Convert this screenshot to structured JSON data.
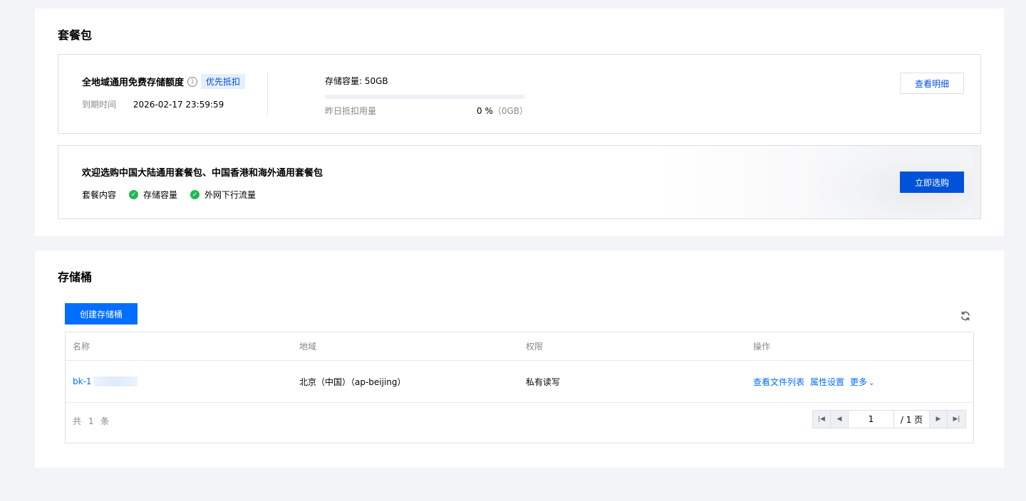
{
  "package_section": {
    "title": "套餐包",
    "plan": {
      "name": "全地域通用免费存储额度",
      "info_icon": "i",
      "tag": "优先抵扣",
      "expire_label": "到期时间",
      "expire_value": "2026-02-17 23:59:59",
      "capacity_label": "存储容量: 50GB",
      "usage_label": "昨日抵扣用量",
      "usage_percent": "0 %",
      "usage_gb": "（0GB）",
      "usage_fraction": 0,
      "detail_button": "查看明细"
    },
    "promo": {
      "title": "欢迎选购中国大陆通用套餐包、中国香港和海外通用套餐包",
      "content_label": "套餐内容",
      "items": [
        "存储容量",
        "外网下行流量"
      ],
      "buy_button": "立即选购"
    }
  },
  "bucket_section": {
    "title": "存储桶",
    "create_button": "创建存储桶",
    "columns": [
      "名称",
      "地域",
      "权限",
      "操作"
    ],
    "rows": [
      {
        "name": "bk-1",
        "region": "北京（中国）（ap-beijing）",
        "permission": "私有读写",
        "actions": [
          "查看文件列表",
          "属性设置",
          "更多"
        ]
      }
    ],
    "total_text": "共 1 条",
    "pagination": {
      "current_page": "1",
      "total_pages": "/ 1 页"
    }
  },
  "colors": {
    "primary": "#006eff",
    "primary_dark": "#0052d9",
    "success": "#1fb855",
    "page_bg": "#f3f4f7"
  }
}
